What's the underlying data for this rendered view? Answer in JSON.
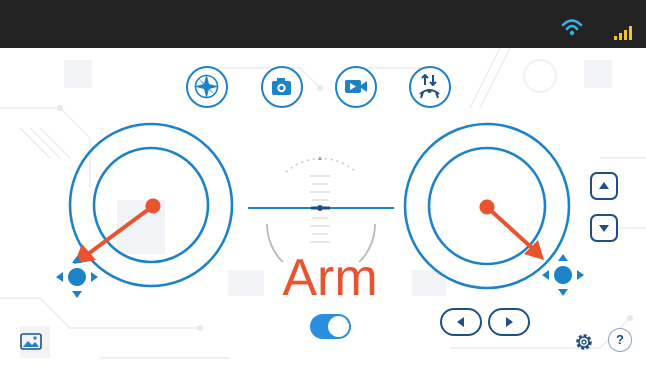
{
  "status_bar": {
    "wifi_icon": "wifi-icon",
    "signal_icon": "signal-bars-icon"
  },
  "toolbar": {
    "buttons": [
      {
        "name": "compass-button",
        "icon": "compass-icon"
      },
      {
        "name": "camera-button",
        "icon": "camera-icon"
      },
      {
        "name": "video-button",
        "icon": "video-camera-icon"
      },
      {
        "name": "takeoff-land-button",
        "icon": "drone-arrows-icon"
      }
    ]
  },
  "arm": {
    "label": "Arm",
    "toggle_on": true
  },
  "colors": {
    "accent": "#1e82c8",
    "arrow": "#e8542e",
    "dark_button": "#1f4f86",
    "topbar": "#232323"
  },
  "icons": {
    "gallery": "image-gallery-icon",
    "settings": "gear-icon",
    "help": "question-mark-icon",
    "up": "triangle-up-icon",
    "down": "triangle-down-icon",
    "left": "triangle-left-icon",
    "right": "triangle-right-icon"
  },
  "help_label": "?"
}
